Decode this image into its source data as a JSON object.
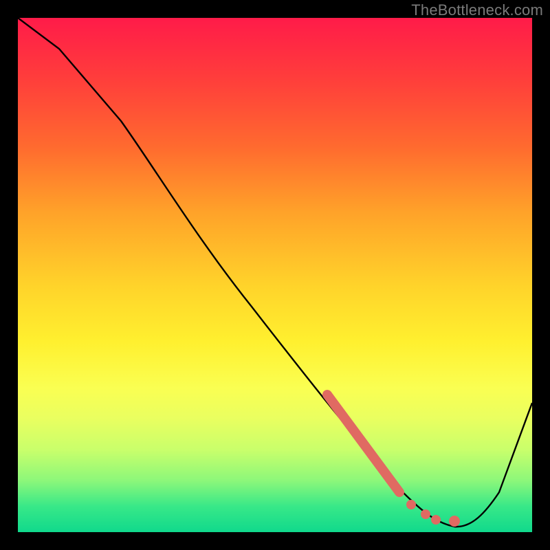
{
  "watermark": "TheBottleneck.com",
  "chart_data": {
    "type": "line",
    "title": "",
    "xlabel": "",
    "ylabel": "",
    "xlim": [
      0,
      100
    ],
    "ylim": [
      0,
      100
    ],
    "grid": false,
    "legend_position": "none",
    "series": [
      {
        "name": "bottleneck-curve",
        "x": [
          0,
          8,
          20,
          30,
          40,
          50,
          60,
          70,
          76,
          80,
          85,
          90,
          93,
          100
        ],
        "y": [
          100,
          94,
          80,
          66,
          53,
          40,
          27,
          14,
          6,
          2,
          1,
          4,
          10,
          25
        ],
        "color": "#000000"
      }
    ],
    "highlight_segment": {
      "comment": "thick salmon stretch on the descending line",
      "x": [
        60,
        63,
        66,
        69,
        72,
        74
      ],
      "y": [
        27,
        23,
        19,
        15,
        11,
        8
      ],
      "color": "#e06a62",
      "width": 12
    },
    "highlight_dots": {
      "comment": "salmon dots near the trough",
      "points": [
        {
          "x": 76,
          "y": 5
        },
        {
          "x": 79,
          "y": 3
        },
        {
          "x": 81,
          "y": 2
        },
        {
          "x": 84.5,
          "y": 2
        }
      ],
      "color": "#e06a62",
      "radius": 7
    }
  },
  "colors": {
    "frame": "#000000",
    "watermark": "#7a7a7a",
    "curve": "#000000",
    "highlight": "#e06a62"
  }
}
